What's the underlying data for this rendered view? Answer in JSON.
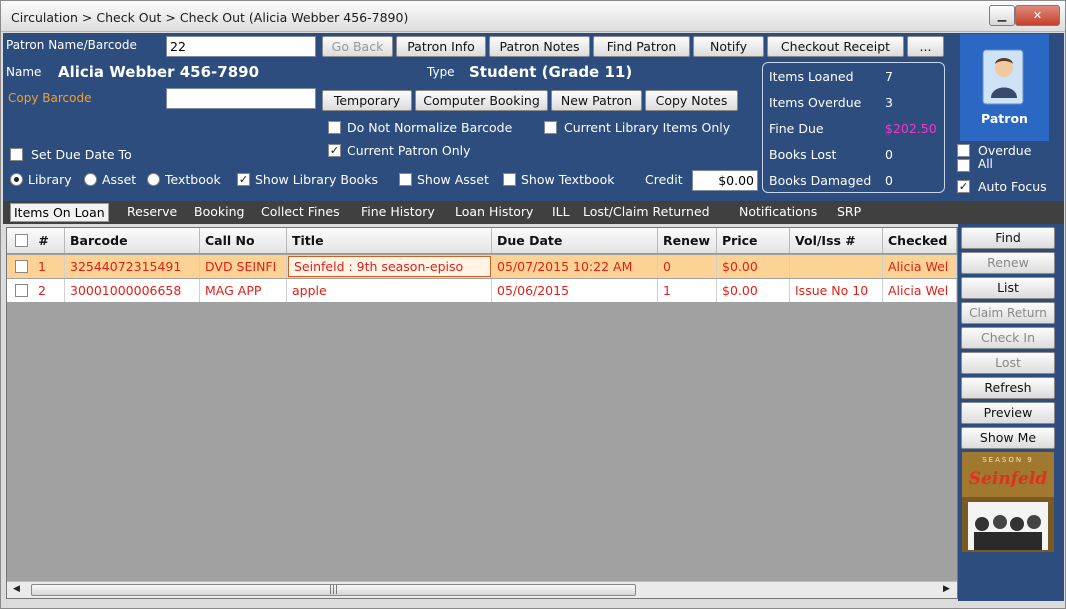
{
  "window": {
    "title": "Circulation > Check Out > Check Out (Alicia  Webber 456-7890)",
    "min_icon": "minimize-icon",
    "close_icon": "close-icon"
  },
  "top": {
    "patron_barcode_label": "Patron Name/Barcode",
    "patron_barcode_value": "22",
    "buttons": {
      "go_back": "Go Back",
      "patron_info": "Patron Info",
      "patron_notes": "Patron Notes",
      "find_patron": "Find Patron",
      "notify": "Notify",
      "checkout_receipt": "Checkout Receipt",
      "more": "..."
    },
    "name_label": "Name",
    "name_value": "Alicia  Webber 456-7890",
    "type_label": "Type",
    "type_value": "Student (Grade 11)",
    "copy_barcode_label": "Copy Barcode",
    "copy_barcode_value": "",
    "buttons2": {
      "temporary": "Temporary",
      "computer_booking": "Computer Booking",
      "new_patron": "New Patron",
      "copy_notes": "Copy Notes"
    },
    "do_not_normalize": "Do Not Normalize Barcode",
    "current_library_items": "Current Library Items Only",
    "current_patron_only": "Current Patron Only",
    "set_due_date": "Set Due Date To",
    "radio_library": "Library",
    "radio_asset": "Asset",
    "radio_textbook": "Textbook",
    "show_library_books": "Show Library Books",
    "show_asset": "Show Asset",
    "show_textbook": "Show Textbook",
    "credit_label": "Credit",
    "credit_value": "$0.00"
  },
  "stats": [
    {
      "k": "Items Loaned",
      "v": "7"
    },
    {
      "k": "Items Overdue",
      "v": "3"
    },
    {
      "k": "Fine Due",
      "v": "$202.50"
    },
    {
      "k": "Books Lost",
      "v": "0"
    },
    {
      "k": "Books Damaged",
      "v": "0"
    }
  ],
  "patron_panel": {
    "label": "Patron",
    "icon": "patron-avatar-icon"
  },
  "right_checks": {
    "overdue": "Overdue",
    "all": "All",
    "auto_focus": "Auto Focus"
  },
  "tabs": [
    "Items On Loan",
    "Reserve",
    "Booking",
    "Collect Fines",
    "Fine History",
    "Loan History",
    "ILL",
    "Lost/Claim Returned",
    "Notifications",
    "SRP"
  ],
  "grid": {
    "columns": [
      "#",
      "Barcode",
      "Call No",
      "Title",
      "Due Date",
      "Renew",
      "Price",
      "Vol/Iss #",
      "Checked"
    ],
    "rows": [
      [
        "1",
        "32544072315491",
        "DVD SEINFI",
        "Seinfeld : 9th season-episo",
        "05/07/2015 10:22 AM",
        "0",
        "$0.00",
        "",
        "Alicia Wel"
      ],
      [
        "2",
        "30001000006658",
        "MAG APP",
        "apple",
        "05/06/2015",
        "1",
        "$0.00",
        "Issue No 10",
        "Alicia Wel"
      ]
    ]
  },
  "side_buttons": [
    "Find",
    "Renew",
    "List",
    "Claim Return",
    "Check In",
    "Lost",
    "Refresh",
    "Preview",
    "Show Me"
  ],
  "poster": {
    "top_text": "SEASON 9",
    "logo_text": "Seinfeld"
  },
  "colors": {
    "panel": "#2c4d7e",
    "accent_orange": "#f0a030",
    "row_selected": "#fcd394",
    "row_text": "#e0201a",
    "fine_pink": "#ff33cc"
  }
}
